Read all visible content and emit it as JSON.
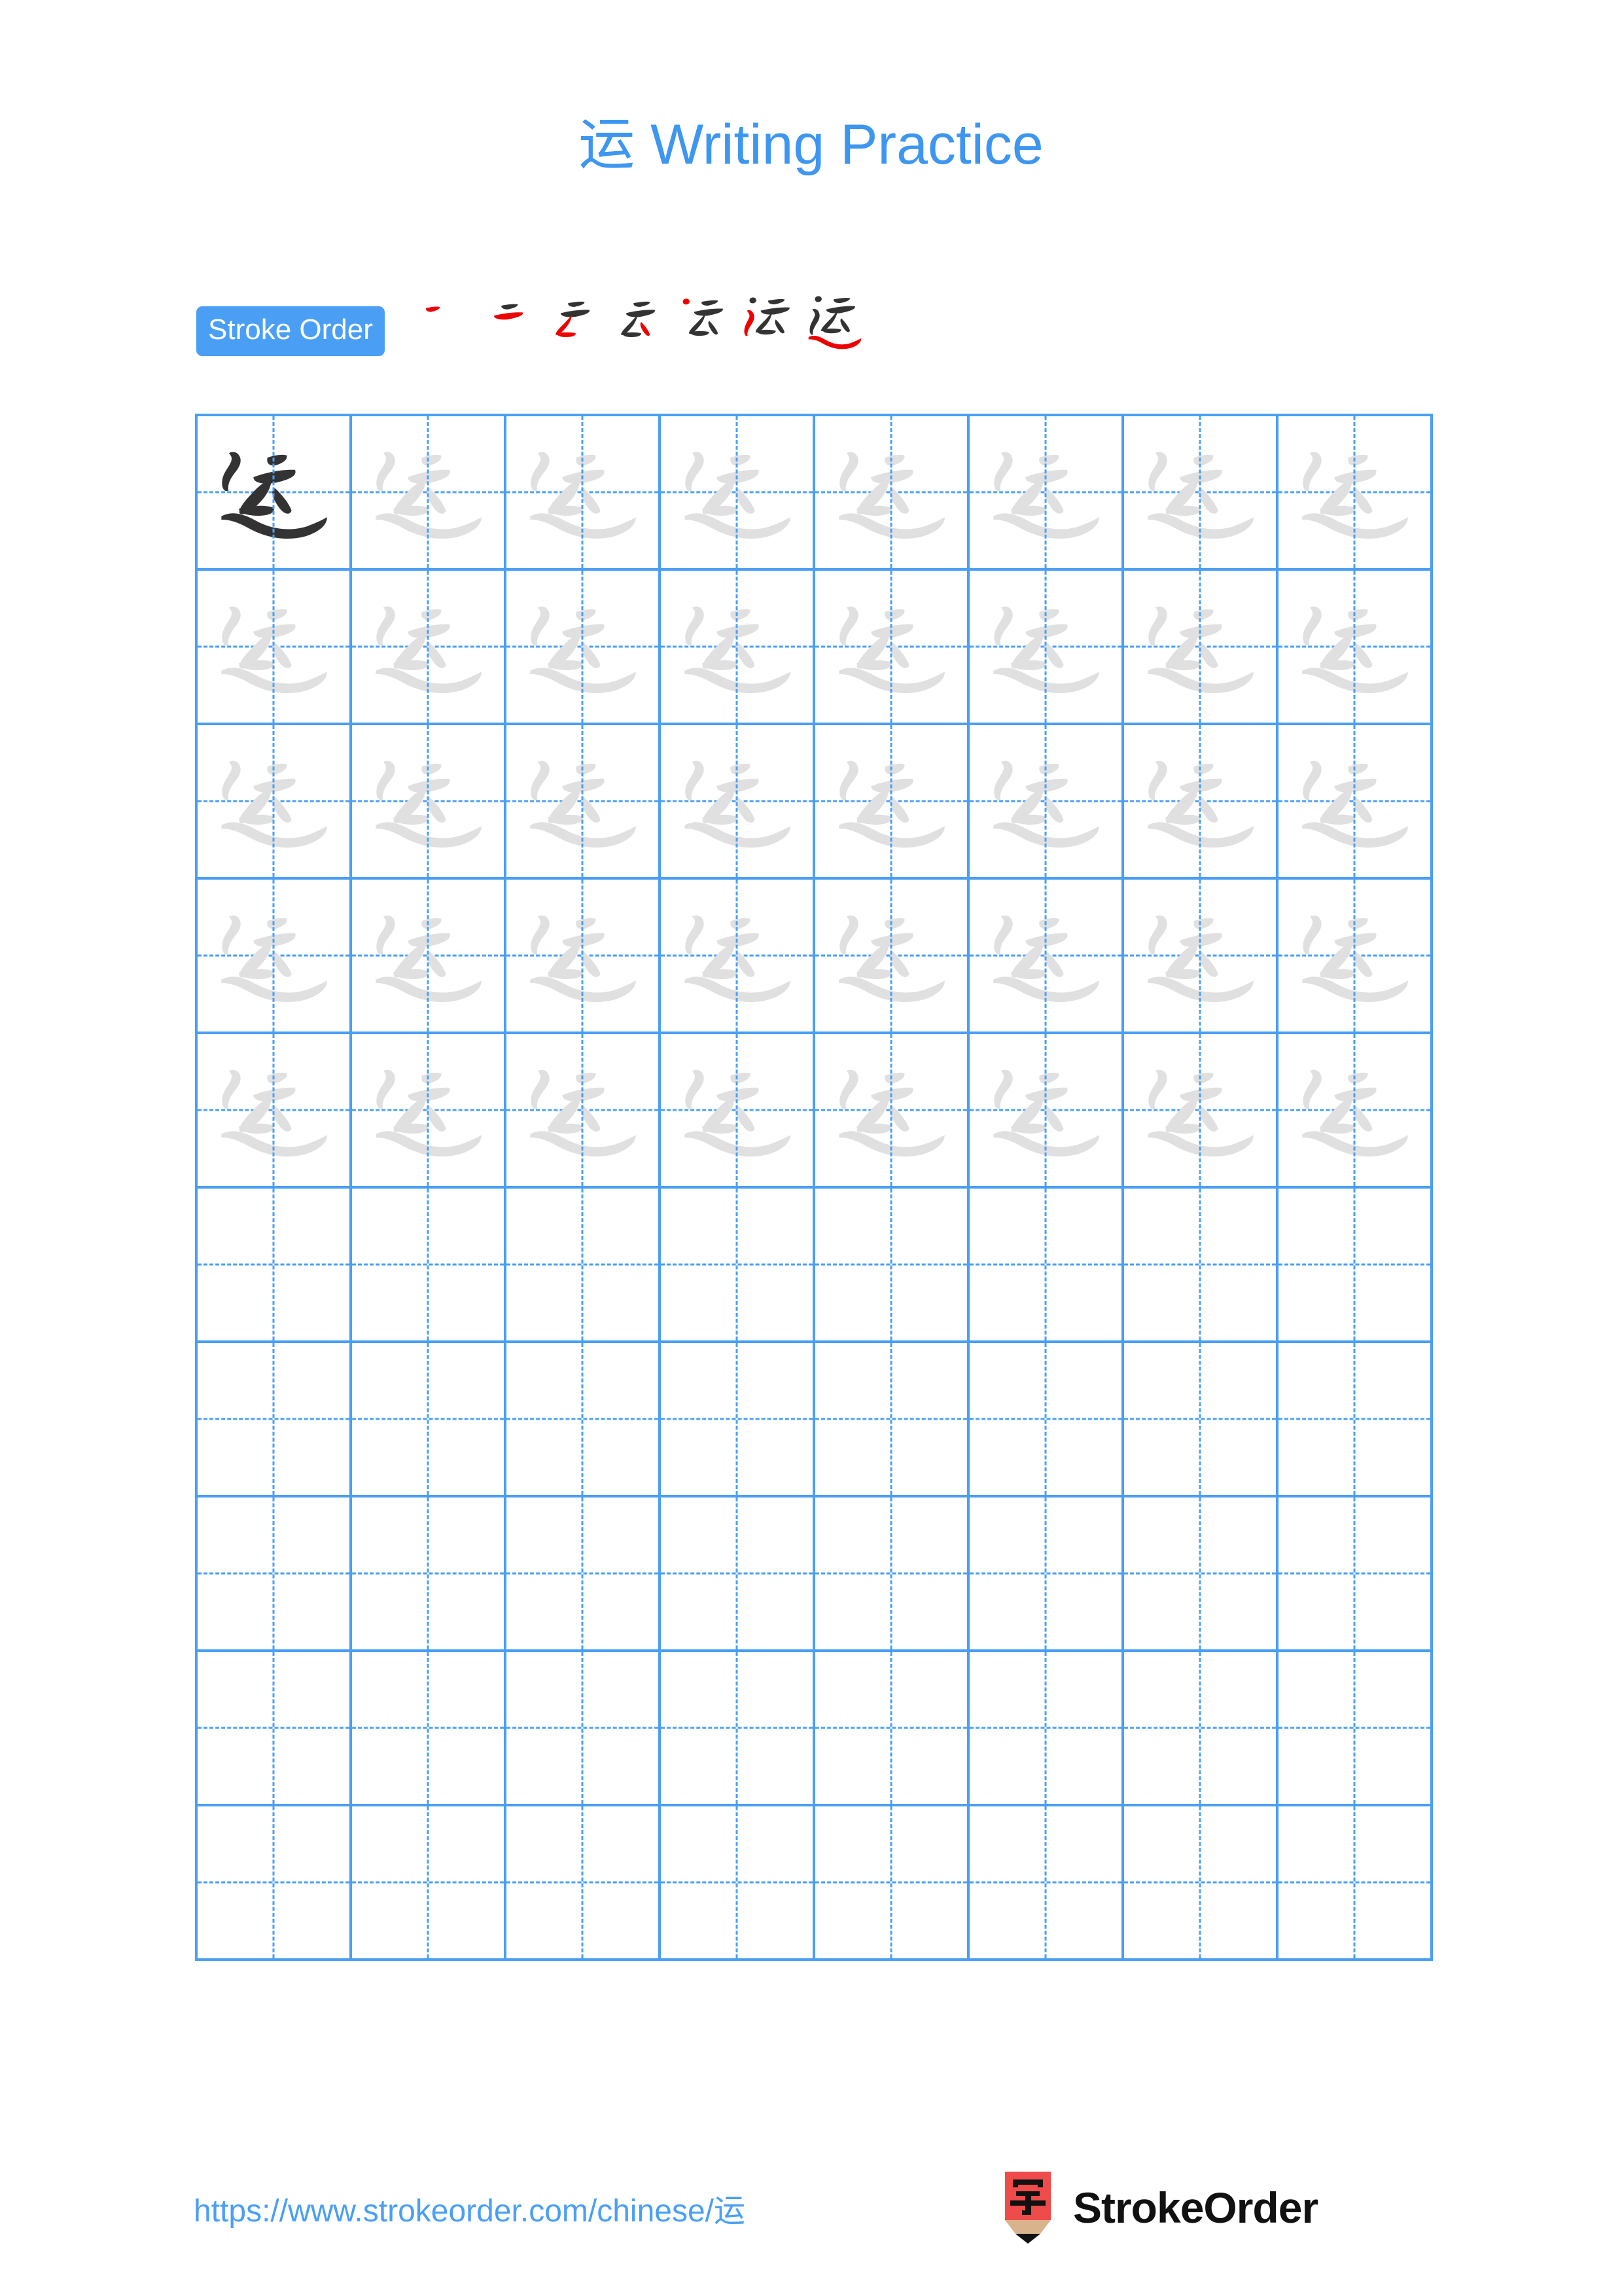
{
  "page": {
    "character": "运",
    "title": "运 Writing Practice",
    "title_suffix": " Writing Practice",
    "background_color": "#ffffff"
  },
  "colors": {
    "accent_blue": "#4a9ff5",
    "title_blue": "#3d96f0",
    "grid_line": "#4a9ff5",
    "trace_gray": "#e0e0e0",
    "model_char_dark": "#333333",
    "new_stroke_red": "#ee0000",
    "prior_stroke_dark": "#333333",
    "logo_red": "#ef4b4b",
    "logo_wood": "#d9b38c",
    "logo_tip": "#111111",
    "brand_text": "#111111"
  },
  "stroke_order": {
    "label": "Stroke Order",
    "total_strokes": 7,
    "steps": [
      {
        "index": 1,
        "strokes_shown": 1,
        "new_stroke_index": 1
      },
      {
        "index": 2,
        "strokes_shown": 2,
        "new_stroke_index": 2
      },
      {
        "index": 3,
        "strokes_shown": 3,
        "new_stroke_index": 3
      },
      {
        "index": 4,
        "strokes_shown": 4,
        "new_stroke_index": 4
      },
      {
        "index": 5,
        "strokes_shown": 5,
        "new_stroke_index": 5
      },
      {
        "index": 6,
        "strokes_shown": 6,
        "new_stroke_index": 6
      },
      {
        "index": 7,
        "strokes_shown": 7,
        "new_stroke_index": 7
      }
    ]
  },
  "grid": {
    "columns": 8,
    "rows": 10,
    "cell_size_px": 236,
    "guide_style": "dashed-crosshair",
    "filled_rows": 5,
    "empty_rows": 5,
    "cells": [
      [
        "dark",
        "trace",
        "trace",
        "trace",
        "trace",
        "trace",
        "trace",
        "trace"
      ],
      [
        "trace",
        "trace",
        "trace",
        "trace",
        "trace",
        "trace",
        "trace",
        "trace"
      ],
      [
        "trace",
        "trace",
        "trace",
        "trace",
        "trace",
        "trace",
        "trace",
        "trace"
      ],
      [
        "trace",
        "trace",
        "trace",
        "trace",
        "trace",
        "trace",
        "trace",
        "trace"
      ],
      [
        "trace",
        "trace",
        "trace",
        "trace",
        "trace",
        "trace",
        "trace",
        "trace"
      ],
      [
        "empty",
        "empty",
        "empty",
        "empty",
        "empty",
        "empty",
        "empty",
        "empty"
      ],
      [
        "empty",
        "empty",
        "empty",
        "empty",
        "empty",
        "empty",
        "empty",
        "empty"
      ],
      [
        "empty",
        "empty",
        "empty",
        "empty",
        "empty",
        "empty",
        "empty",
        "empty"
      ],
      [
        "empty",
        "empty",
        "empty",
        "empty",
        "empty",
        "empty",
        "empty",
        "empty"
      ],
      [
        "empty",
        "empty",
        "empty",
        "empty",
        "empty",
        "empty",
        "empty",
        "empty"
      ]
    ]
  },
  "footer": {
    "url": "https://www.strokeorder.com/chinese/运",
    "brand_name": "StrokeOrder",
    "logo_char": "字"
  }
}
